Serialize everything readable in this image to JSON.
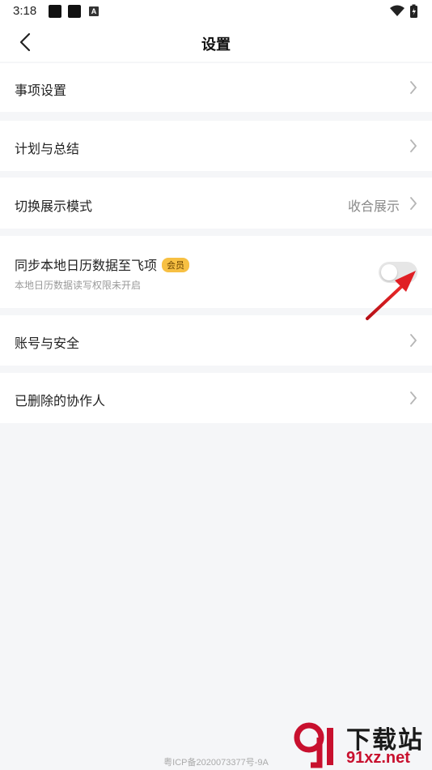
{
  "status_bar": {
    "time": "3:18",
    "letter_icon": "A"
  },
  "header": {
    "title": "设置",
    "back_icon": "chevron-left-icon"
  },
  "settings": {
    "items": [
      {
        "label": "事项设置"
      },
      {
        "label": "计划与总结"
      },
      {
        "label": "切换展示模式",
        "value": "收合展示"
      },
      {
        "label": "同步本地日历数据至飞项",
        "badge": "会员",
        "subtitle": "本地日历数据读写权限未开启",
        "toggle_on": false
      },
      {
        "label": "账号与安全"
      },
      {
        "label": "已删除的协作人"
      }
    ]
  },
  "footer": {
    "icp": "粤ICP备2020073377号-9A"
  },
  "watermark": {
    "title": "下载站",
    "url": "91xz.net"
  },
  "colors": {
    "badge": "#f7c043",
    "arrow": "#d9141d",
    "watermark_red": "#c8102e"
  }
}
